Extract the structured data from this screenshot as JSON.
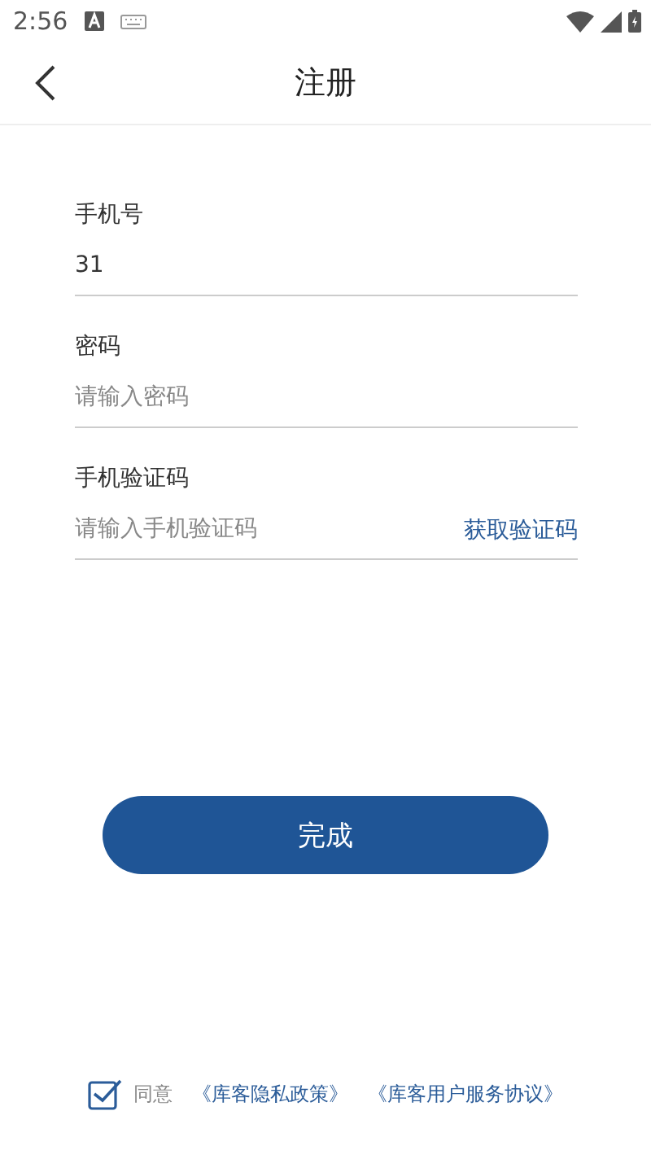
{
  "status_bar": {
    "time": "2:56"
  },
  "header": {
    "title": "注册"
  },
  "fields": [
    {
      "label": "手机号",
      "value": "31"
    },
    {
      "label": "密码",
      "placeholder": "请输入密码"
    },
    {
      "label": "手机验证码",
      "placeholder": "请输入手机验证码",
      "action": "获取验证码"
    }
  ],
  "submit_button": "完成",
  "agreement": {
    "checked": true,
    "text": "同意",
    "links": [
      "《库客隐私政策》",
      "《库客用户服务协议》"
    ]
  }
}
